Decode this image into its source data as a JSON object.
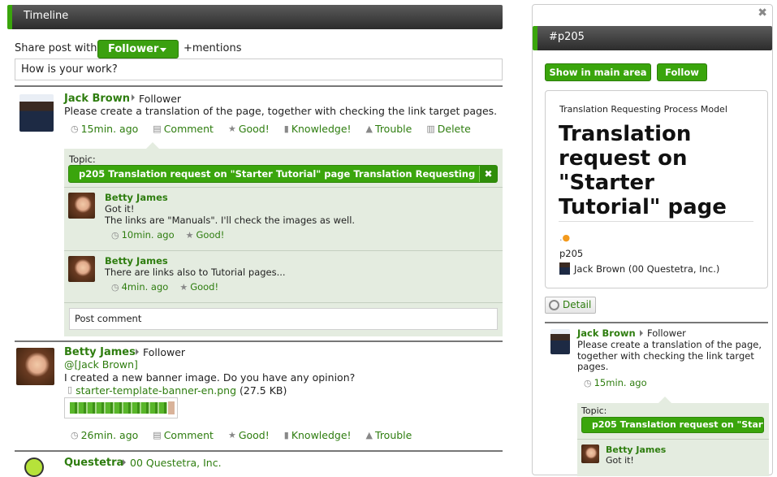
{
  "timeline": {
    "title": "Timeline",
    "share_label": "Share post with:",
    "share_value": "Follower",
    "mentions": "+mentions",
    "post_placeholder": "How is your work?",
    "posts": [
      {
        "author": "Jack Brown",
        "audience": "Follower",
        "text": "Please create a translation of the page, together with checking the link target pages.",
        "time": "15min. ago",
        "actions": [
          "Comment",
          "Good!",
          "Knowledge!",
          "Trouble",
          "Delete"
        ],
        "topic_label": "Topic:",
        "topic": "p205 Translation request on \"Starter Tutorial\" page Translation Requesting Proc...",
        "comments": [
          {
            "author": "Betty James",
            "lines": [
              "Got it!",
              "The links are \"Manuals\". I'll check the images as well."
            ],
            "time": "10min. ago",
            "good": "Good!"
          },
          {
            "author": "Betty James",
            "lines": [
              "There are links also to Tutorial pages..."
            ],
            "time": "4min. ago",
            "good": "Good!"
          }
        ],
        "comment_placeholder": "Post comment"
      },
      {
        "author": "Betty James",
        "audience": "Follower",
        "mention": "@[Jack Brown]",
        "text": "I created a new banner image. Do you have any opinion?",
        "file": "starter-template-banner-en.png",
        "file_size": "(27.5 KB)",
        "time": "26min. ago",
        "actions": [
          "Comment",
          "Good!",
          "Knowledge!",
          "Trouble"
        ]
      },
      {
        "author": "Questetra",
        "audience": "00 Questetra, Inc."
      }
    ]
  },
  "panel": {
    "title": "#p205",
    "show_button": "Show in main area",
    "follow_button": "Follow",
    "model": "Translation Requesting Process Model",
    "heading": "Translation request on \"Starter Tutorial\" page",
    "dot_prefix": ".",
    "dot": "●",
    "id": "p205",
    "user": "Jack Brown (00 Questetra, Inc.)",
    "detail": "Detail",
    "post": {
      "author": "Jack Brown",
      "audience": "Follower",
      "lines": [
        "Please create a translation of the page,",
        "together with checking the link target",
        "pages."
      ],
      "time": "15min. ago",
      "topic_label": "Topic:",
      "topic": "p205 Translation request on \"Starte...",
      "comment_author": "Betty James",
      "comment_text": "Got it!"
    }
  },
  "colors": {
    "accent": "#3aa50c",
    "link": "#2e7d0f",
    "topic_bg": "#e4ece0"
  }
}
